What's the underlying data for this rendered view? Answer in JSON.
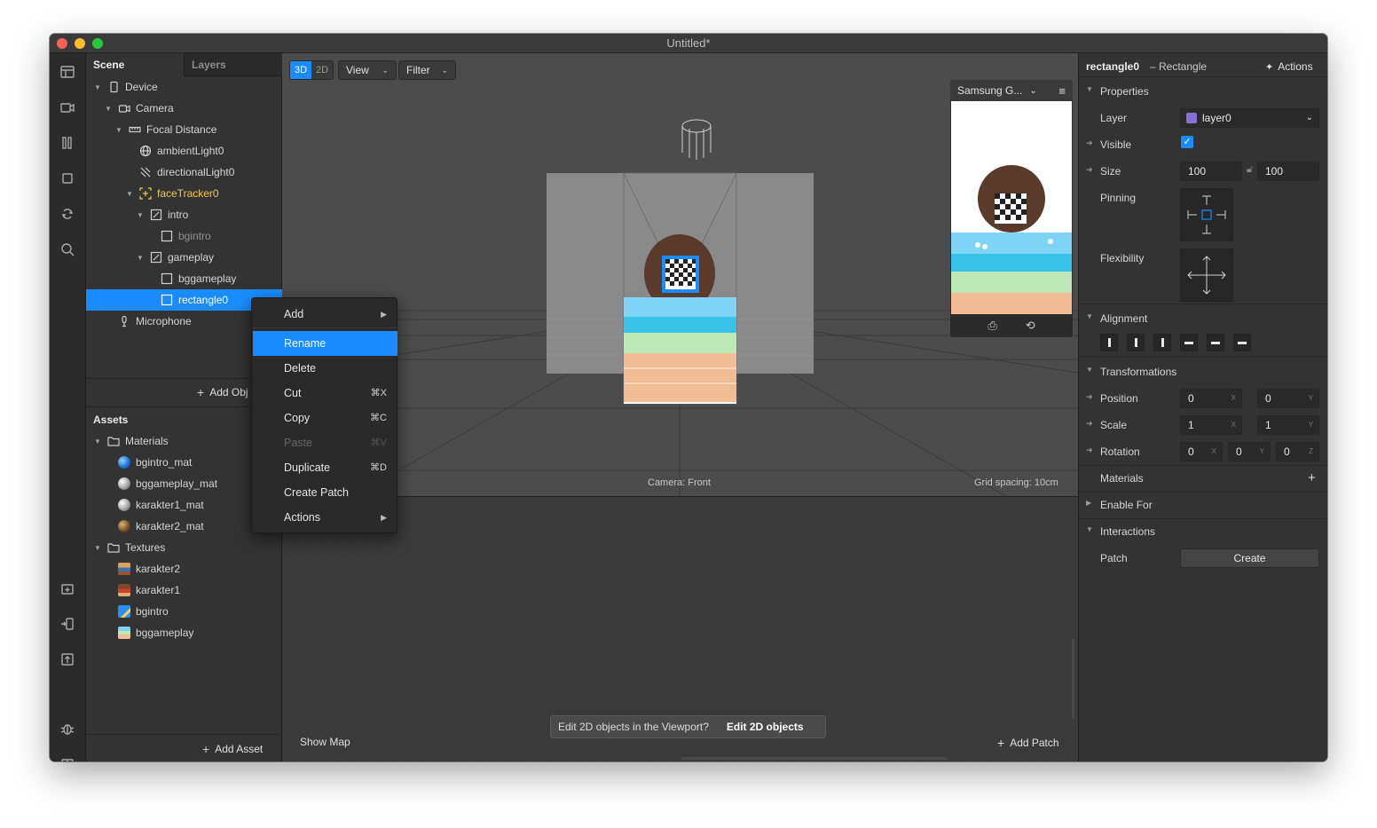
{
  "window": {
    "title": "Untitled*"
  },
  "toolbar": {
    "icons": [
      "layout-icon",
      "video-icon",
      "columns-icon",
      "square-icon",
      "sync-icon",
      "search-icon",
      "import-icon",
      "export-icon",
      "upload-icon",
      "bug-icon",
      "book-icon"
    ]
  },
  "scene_panel": {
    "tabs": [
      "Scene",
      "Layers"
    ],
    "tree": [
      {
        "label": "Device"
      },
      {
        "label": "Camera"
      },
      {
        "label": "Focal Distance"
      },
      {
        "label": "ambientLight0"
      },
      {
        "label": "directionalLight0"
      },
      {
        "label": "faceTracker0"
      },
      {
        "label": "intro"
      },
      {
        "label": "bgintro"
      },
      {
        "label": "gameplay"
      },
      {
        "label": "bggameplay"
      },
      {
        "label": "rectangle0"
      },
      {
        "label": "Microphone"
      }
    ],
    "add_object": "Add Obj",
    "assets_title": "Assets",
    "assets": [
      {
        "label": "Materials"
      },
      {
        "label": "bgintro_mat"
      },
      {
        "label": "bggameplay_mat"
      },
      {
        "label": "karakter1_mat"
      },
      {
        "label": "karakter2_mat"
      },
      {
        "label": "Textures"
      },
      {
        "label": "karakter2"
      },
      {
        "label": "karakter1"
      },
      {
        "label": "bgintro"
      },
      {
        "label": "bggameplay"
      }
    ],
    "add_asset": "Add Asset"
  },
  "viewport": {
    "mode_3d": "3D",
    "mode_2d": "2D",
    "view_label": "View",
    "filter_label": "Filter",
    "device_label": "Samsung G...",
    "camera_label": "Camera: Front",
    "grid_label": "Grid spacing: 10cm"
  },
  "patch_editor": {
    "show_map": "Show Map",
    "add_patch": "Add Patch",
    "toast_text": "Edit 2D objects in the Viewport?",
    "toast_action": "Edit 2D objects"
  },
  "context_menu": {
    "items": [
      {
        "label": "Add",
        "shortcut": "",
        "submenu": true
      },
      {
        "label": "Rename",
        "shortcut": ""
      },
      {
        "label": "Delete",
        "shortcut": ""
      },
      {
        "label": "Cut",
        "shortcut": "⌘X"
      },
      {
        "label": "Copy",
        "shortcut": "⌘C"
      },
      {
        "label": "Paste",
        "shortcut": "⌘V",
        "disabled": true
      },
      {
        "label": "Duplicate",
        "shortcut": "⌘D"
      },
      {
        "label": "Create Patch",
        "shortcut": ""
      },
      {
        "label": "Actions",
        "shortcut": "",
        "submenu": true
      }
    ],
    "highlighted": "Rename"
  },
  "inspector": {
    "object_name": "rectangle0",
    "object_type": "– Rectangle",
    "actions_label": "Actions",
    "properties_title": "Properties",
    "layer_label": "Layer",
    "layer_value": "layer0",
    "layer_color": "#8a6fd6",
    "visible_label": "Visible",
    "visible_checked": true,
    "size_label": "Size",
    "size_w": "100",
    "size_h": "100",
    "pinning_label": "Pinning",
    "flexibility_label": "Flexibility",
    "alignment_title": "Alignment",
    "transformations_title": "Transformations",
    "position_label": "Position",
    "position": [
      "0",
      "0"
    ],
    "scale_label": "Scale",
    "scale": [
      "1",
      "1"
    ],
    "rotation_label": "Rotation",
    "rotation": [
      "0",
      "0",
      "0"
    ],
    "axes": [
      "X",
      "Y",
      "Z"
    ],
    "materials_label": "Materials",
    "enable_for_label": "Enable For",
    "interactions_title": "Interactions",
    "patch_label": "Patch",
    "create_label": "Create"
  },
  "colors": {
    "accent": "#1a8cff",
    "highlight_yellow": "#f3c94a"
  }
}
